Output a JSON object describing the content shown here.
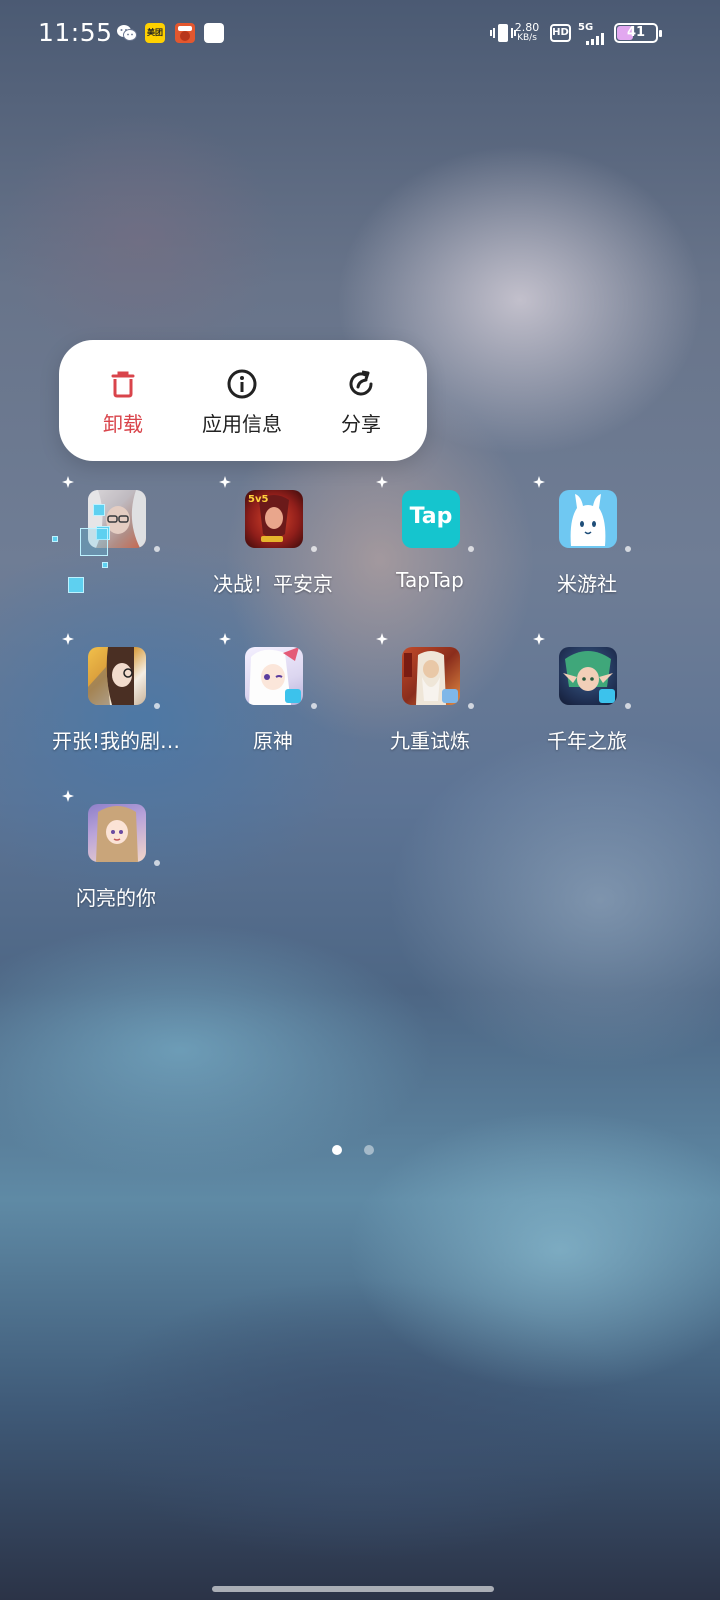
{
  "status_bar": {
    "time": "11:55",
    "net_speed_value": "2.80",
    "net_speed_unit": "KB/s",
    "hd_label": "HD",
    "network_label": "5G",
    "battery_level": "41",
    "notification_icons": [
      "wechat-icon",
      "meituan-icon",
      "game-app-icon",
      "blank-app-icon"
    ],
    "meituan_text": "美团"
  },
  "context_menu": {
    "items": [
      {
        "label": "卸载",
        "icon": "trash-icon",
        "color": "#d9444b"
      },
      {
        "label": "应用信息",
        "icon": "info-icon"
      },
      {
        "label": "分享",
        "icon": "share-icon"
      }
    ]
  },
  "apps": [
    {
      "label": "",
      "icon": "app-being-uninstalled-icon"
    },
    {
      "label": "决战！平安京",
      "icon": "onmyoji-arena-icon"
    },
    {
      "label": "TapTap",
      "icon": "taptap-icon",
      "icon_text": "Tap"
    },
    {
      "label": "米游社",
      "icon": "miyoushe-icon"
    },
    {
      "label": "开张!我的剧…",
      "icon": "theater-game-icon"
    },
    {
      "label": "原神",
      "icon": "genshin-icon"
    },
    {
      "label": "九重试炼",
      "icon": "jiuchong-icon"
    },
    {
      "label": "千年之旅",
      "icon": "qiannian-icon"
    },
    {
      "label": "闪亮的你",
      "icon": "shining-you-icon"
    }
  ],
  "pager": {
    "current": 1,
    "total": 2
  }
}
